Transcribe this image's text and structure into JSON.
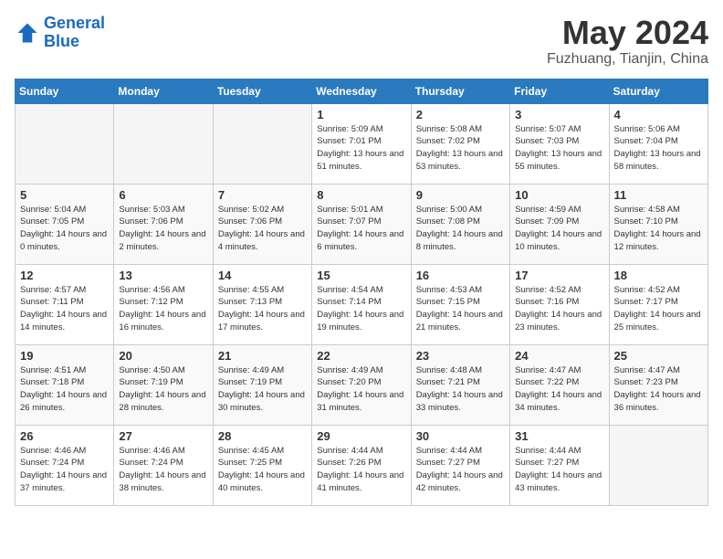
{
  "header": {
    "logo_line1": "General",
    "logo_line2": "Blue",
    "month": "May 2024",
    "location": "Fuzhuang, Tianjin, China"
  },
  "days_of_week": [
    "Sunday",
    "Monday",
    "Tuesday",
    "Wednesday",
    "Thursday",
    "Friday",
    "Saturday"
  ],
  "weeks": [
    [
      {
        "day": "",
        "empty": true
      },
      {
        "day": "",
        "empty": true
      },
      {
        "day": "",
        "empty": true
      },
      {
        "day": "1",
        "sunrise": "5:09 AM",
        "sunset": "7:01 PM",
        "daylight": "13 hours and 51 minutes."
      },
      {
        "day": "2",
        "sunrise": "5:08 AM",
        "sunset": "7:02 PM",
        "daylight": "13 hours and 53 minutes."
      },
      {
        "day": "3",
        "sunrise": "5:07 AM",
        "sunset": "7:03 PM",
        "daylight": "13 hours and 55 minutes."
      },
      {
        "day": "4",
        "sunrise": "5:06 AM",
        "sunset": "7:04 PM",
        "daylight": "13 hours and 58 minutes."
      }
    ],
    [
      {
        "day": "5",
        "sunrise": "5:04 AM",
        "sunset": "7:05 PM",
        "daylight": "14 hours and 0 minutes."
      },
      {
        "day": "6",
        "sunrise": "5:03 AM",
        "sunset": "7:06 PM",
        "daylight": "14 hours and 2 minutes."
      },
      {
        "day": "7",
        "sunrise": "5:02 AM",
        "sunset": "7:06 PM",
        "daylight": "14 hours and 4 minutes."
      },
      {
        "day": "8",
        "sunrise": "5:01 AM",
        "sunset": "7:07 PM",
        "daylight": "14 hours and 6 minutes."
      },
      {
        "day": "9",
        "sunrise": "5:00 AM",
        "sunset": "7:08 PM",
        "daylight": "14 hours and 8 minutes."
      },
      {
        "day": "10",
        "sunrise": "4:59 AM",
        "sunset": "7:09 PM",
        "daylight": "14 hours and 10 minutes."
      },
      {
        "day": "11",
        "sunrise": "4:58 AM",
        "sunset": "7:10 PM",
        "daylight": "14 hours and 12 minutes."
      }
    ],
    [
      {
        "day": "12",
        "sunrise": "4:57 AM",
        "sunset": "7:11 PM",
        "daylight": "14 hours and 14 minutes."
      },
      {
        "day": "13",
        "sunrise": "4:56 AM",
        "sunset": "7:12 PM",
        "daylight": "14 hours and 16 minutes."
      },
      {
        "day": "14",
        "sunrise": "4:55 AM",
        "sunset": "7:13 PM",
        "daylight": "14 hours and 17 minutes."
      },
      {
        "day": "15",
        "sunrise": "4:54 AM",
        "sunset": "7:14 PM",
        "daylight": "14 hours and 19 minutes."
      },
      {
        "day": "16",
        "sunrise": "4:53 AM",
        "sunset": "7:15 PM",
        "daylight": "14 hours and 21 minutes."
      },
      {
        "day": "17",
        "sunrise": "4:52 AM",
        "sunset": "7:16 PM",
        "daylight": "14 hours and 23 minutes."
      },
      {
        "day": "18",
        "sunrise": "4:52 AM",
        "sunset": "7:17 PM",
        "daylight": "14 hours and 25 minutes."
      }
    ],
    [
      {
        "day": "19",
        "sunrise": "4:51 AM",
        "sunset": "7:18 PM",
        "daylight": "14 hours and 26 minutes."
      },
      {
        "day": "20",
        "sunrise": "4:50 AM",
        "sunset": "7:19 PM",
        "daylight": "14 hours and 28 minutes."
      },
      {
        "day": "21",
        "sunrise": "4:49 AM",
        "sunset": "7:19 PM",
        "daylight": "14 hours and 30 minutes."
      },
      {
        "day": "22",
        "sunrise": "4:49 AM",
        "sunset": "7:20 PM",
        "daylight": "14 hours and 31 minutes."
      },
      {
        "day": "23",
        "sunrise": "4:48 AM",
        "sunset": "7:21 PM",
        "daylight": "14 hours and 33 minutes."
      },
      {
        "day": "24",
        "sunrise": "4:47 AM",
        "sunset": "7:22 PM",
        "daylight": "14 hours and 34 minutes."
      },
      {
        "day": "25",
        "sunrise": "4:47 AM",
        "sunset": "7:23 PM",
        "daylight": "14 hours and 36 minutes."
      }
    ],
    [
      {
        "day": "26",
        "sunrise": "4:46 AM",
        "sunset": "7:24 PM",
        "daylight": "14 hours and 37 minutes."
      },
      {
        "day": "27",
        "sunrise": "4:46 AM",
        "sunset": "7:24 PM",
        "daylight": "14 hours and 38 minutes."
      },
      {
        "day": "28",
        "sunrise": "4:45 AM",
        "sunset": "7:25 PM",
        "daylight": "14 hours and 40 minutes."
      },
      {
        "day": "29",
        "sunrise": "4:44 AM",
        "sunset": "7:26 PM",
        "daylight": "14 hours and 41 minutes."
      },
      {
        "day": "30",
        "sunrise": "4:44 AM",
        "sunset": "7:27 PM",
        "daylight": "14 hours and 42 minutes."
      },
      {
        "day": "31",
        "sunrise": "4:44 AM",
        "sunset": "7:27 PM",
        "daylight": "14 hours and 43 minutes."
      },
      {
        "day": "",
        "empty": true
      }
    ]
  ]
}
